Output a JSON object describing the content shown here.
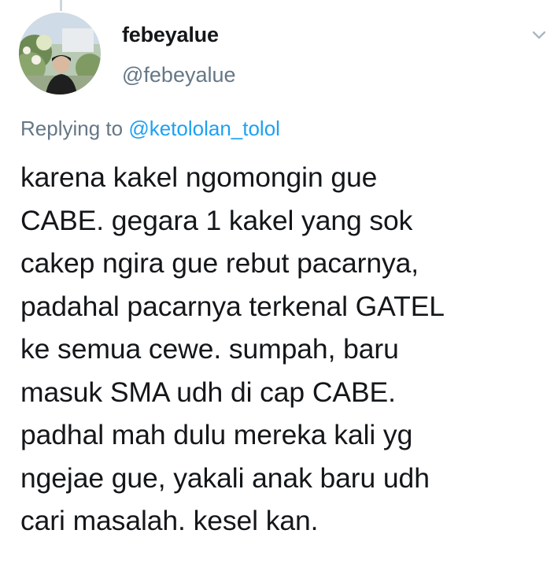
{
  "author": {
    "display_name": "febeyalue",
    "handle": "@febeyalue"
  },
  "reply": {
    "prefix": "Replying to",
    "target": "@ketololan_tolol"
  },
  "tweet": {
    "lines": [
      "karena kakel ngomongin gue",
      "CABE. gegara 1 kakel yang sok",
      "cakep ngira gue rebut pacarnya,",
      "padahal pacarnya terkenal GATEL",
      "ke semua cewe. sumpah, baru",
      "masuk SMA udh di cap CABE.",
      "padhal mah dulu mereka kali yg",
      "ngejae gue, yakali anak baru udh",
      "cari masalah. kesel kan."
    ]
  },
  "icons": {
    "menu": "chevron-down-icon"
  },
  "colors": {
    "name": "#14171a",
    "secondary": "#657786",
    "link": "#1da1f2"
  }
}
